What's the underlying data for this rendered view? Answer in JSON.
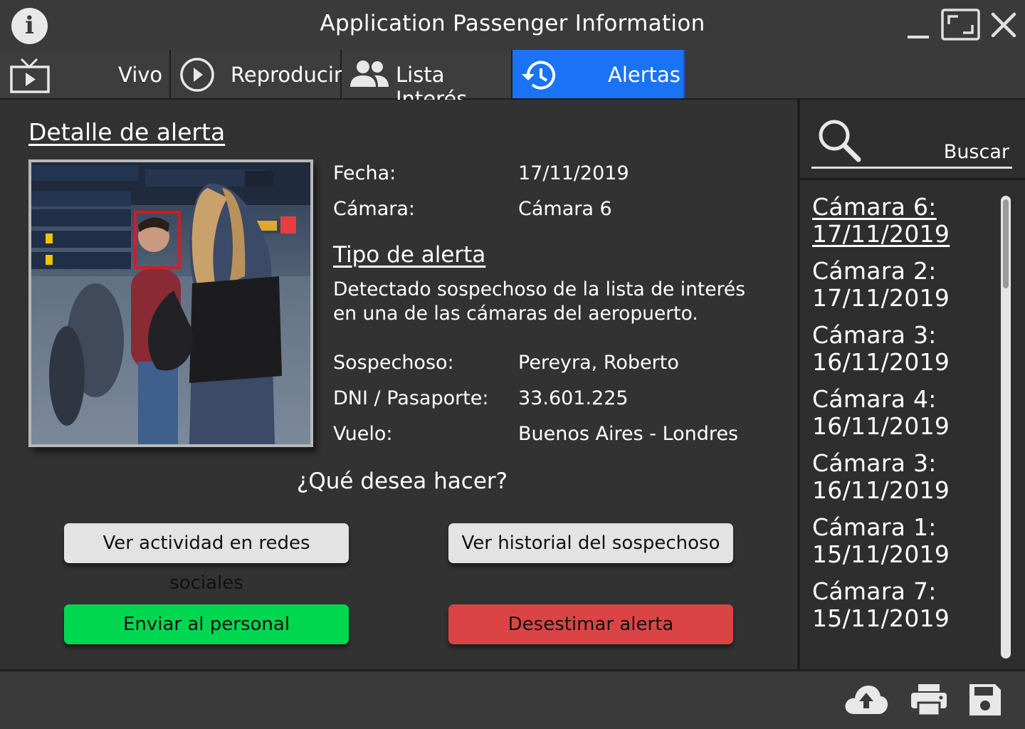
{
  "window": {
    "title": "Application Passenger Information",
    "info_icon": "info-icon",
    "controls": [
      "minimize-icon",
      "maximize-icon",
      "close-icon"
    ]
  },
  "tabs": [
    {
      "label": "Vivo",
      "icon": "tv-icon",
      "active": false
    },
    {
      "label": "Reproducir",
      "icon": "play-circle-icon",
      "active": false
    },
    {
      "label": "Lista Interés",
      "icon": "people-icon",
      "active": false
    },
    {
      "label": "Alertas",
      "icon": "history-icon",
      "active": true
    }
  ],
  "accent_color": "#1a73f5",
  "detail": {
    "title": "Detalle de alerta",
    "fields_top": [
      {
        "label": "Fecha:",
        "value": "17/11/2019"
      },
      {
        "label": "Cámara:",
        "value": "Cámara 6"
      }
    ],
    "alert_type_title": "Tipo de alerta",
    "alert_type_desc": "Detectado sospechoso de la lista de interés en una de las cámaras del aeropuerto.",
    "fields_bottom": [
      {
        "label": "Sospechoso:",
        "value": "Pereyra, Roberto"
      },
      {
        "label": "DNI / Pasaporte:",
        "value": "33.601.225"
      },
      {
        "label": "Vuelo:",
        "value": "Buenos Aires - Londres"
      }
    ],
    "question": "¿Qué desea hacer?",
    "buttons": {
      "social": "Ver actividad en redes sociales",
      "history": "Ver historial del sospechoso",
      "send": "Enviar al personal",
      "dismiss": "Desestimar alerta"
    },
    "button_colors": {
      "send": "#00d750",
      "dismiss": "#db4444"
    }
  },
  "sidebar": {
    "search_label": "Buscar",
    "alerts": [
      {
        "camera": "Cámara 6:",
        "date": "17/11/2019",
        "selected": true
      },
      {
        "camera": "Cámara 2:",
        "date": "17/11/2019",
        "selected": false
      },
      {
        "camera": "Cámara 3:",
        "date": "16/11/2019",
        "selected": false
      },
      {
        "camera": "Cámara 4:",
        "date": "16/11/2019",
        "selected": false
      },
      {
        "camera": "Cámara 3:",
        "date": "16/11/2019",
        "selected": false
      },
      {
        "camera": "Cámara 1:",
        "date": "15/11/2019",
        "selected": false
      },
      {
        "camera": "Cámara 7:",
        "date": "15/11/2019",
        "selected": false
      }
    ]
  },
  "footer_icons": [
    "cloud-upload-icon",
    "print-icon",
    "save-icon"
  ]
}
